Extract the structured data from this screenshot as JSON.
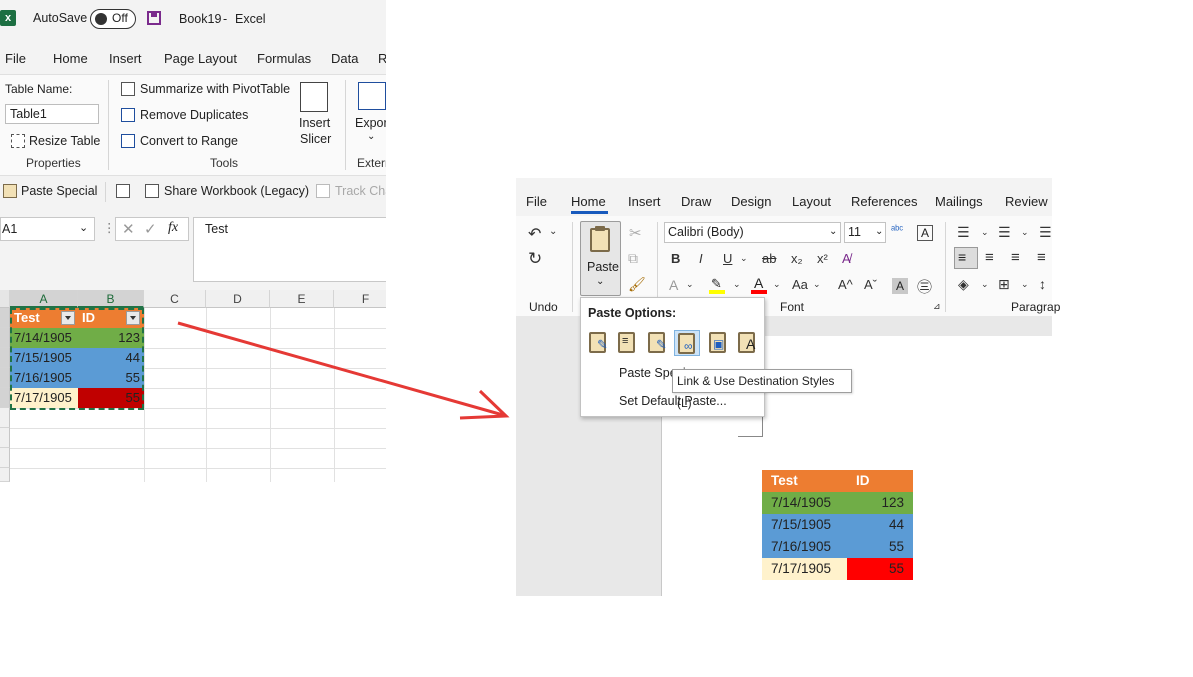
{
  "colors": {
    "header": "#ed7d31",
    "green": "#70ad47",
    "blue": "#5b9bd5",
    "red_excel": "#c00000",
    "red_word": "#ff0000",
    "beige": "#fff2cc",
    "arrow": "#e53935",
    "excel_accent": "#217346",
    "word_accent": "#185abd"
  },
  "excel": {
    "title_bar": {
      "autosave": "AutoSave",
      "toggle": "Off",
      "doc": "Book19",
      "sep": "-",
      "app": "Excel"
    },
    "tabs": [
      "File",
      "Home",
      "Insert",
      "Page Layout",
      "Formulas",
      "Data",
      "R"
    ],
    "ribbon": {
      "table_name_label": "Table Name:",
      "table_name_value": "Table1",
      "resize_table": "Resize Table",
      "summarize": "Summarize with PivotTable",
      "remove_duplicates": "Remove Duplicates",
      "convert_to_range": "Convert to Range",
      "insert_slicer_1": "Insert",
      "insert_slicer_2": "Slicer",
      "export": "Expor",
      "groups": [
        "Properties",
        "Tools",
        "Extern"
      ]
    },
    "qat": {
      "paste_special": "Paste Special",
      "share_workbook": "Share Workbook (Legacy)",
      "track_changes": "Track Cha"
    },
    "name_box": "A1",
    "fx": "fx",
    "formula_value": "Test",
    "columns": [
      "A",
      "B",
      "C",
      "D",
      "E",
      "F"
    ],
    "table": {
      "headers": [
        "Test",
        "ID"
      ],
      "rows": [
        {
          "date": "7/14/1905",
          "id": "123",
          "color": "green"
        },
        {
          "date": "7/15/1905",
          "id": "44",
          "color": "blue"
        },
        {
          "date": "7/16/1905",
          "id": "55",
          "color": "blue"
        },
        {
          "date": "7/17/1905",
          "id": "55",
          "color": "red"
        }
      ]
    }
  },
  "word": {
    "tabs": [
      "File",
      "Home",
      "Insert",
      "Draw",
      "Design",
      "Layout",
      "References",
      "Mailings",
      "Review"
    ],
    "font_name": "Calibri (Body)",
    "font_size": "11",
    "paste_label": "Paste",
    "groups": {
      "undo": "Undo",
      "font": "Font",
      "paragraph": "Paragrap"
    },
    "format_buttons": {
      "bold": "B",
      "italic": "I",
      "underline": "U",
      "strike": "ab",
      "sub": "x₂",
      "sup": "x²",
      "grow": "A^",
      "shrink": "Aˇ",
      "case": "Aa"
    },
    "paste_menu": {
      "title": "Paste Options:",
      "options": [
        "keep-source-formatting",
        "use-destination-styles",
        "link-keep-source",
        "link-destination-styles",
        "picture",
        "keep-text-only"
      ],
      "paste_special": "Paste Speci",
      "set_default": "Set Default Paste..."
    },
    "tooltip": "Link & Use Destination Styles (L)",
    "table": {
      "headers": [
        "Test",
        "ID"
      ],
      "rows": [
        {
          "date": "7/14/1905",
          "id": "123"
        },
        {
          "date": "7/15/1905",
          "id": "44"
        },
        {
          "date": "7/16/1905",
          "id": "55"
        },
        {
          "date": "7/17/1905",
          "id": "55"
        }
      ]
    }
  }
}
